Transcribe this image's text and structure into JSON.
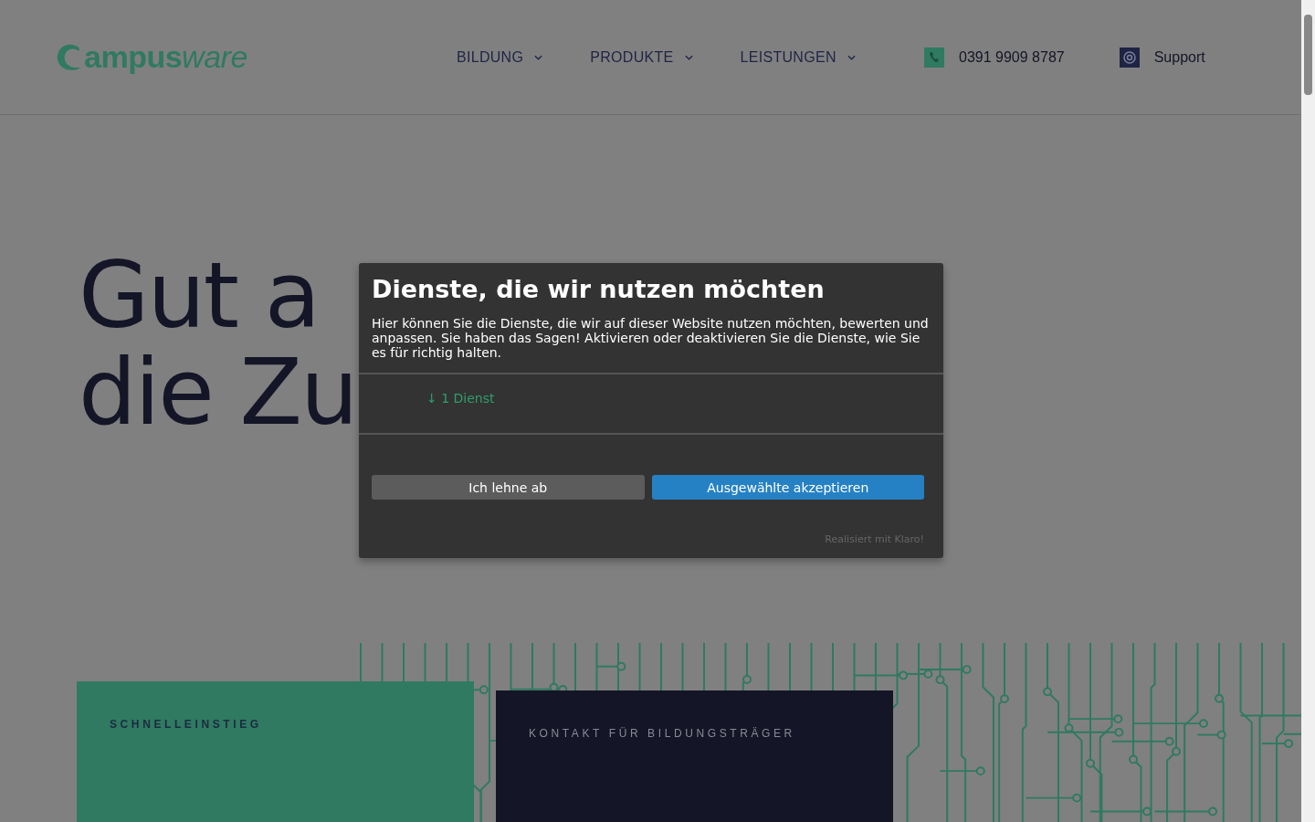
{
  "header": {
    "logo": {
      "bold": "ampus",
      "light": "ware"
    },
    "nav": [
      {
        "label": "BILDUNG",
        "has_dropdown": true
      },
      {
        "label": "PRODUKTE",
        "has_dropdown": true
      },
      {
        "label": "LEISTUNGEN",
        "has_dropdown": true
      }
    ],
    "phone": "0391 9909 8787",
    "support": "Support"
  },
  "hero": {
    "lines": [
      "Gut a",
      "die Zu"
    ]
  },
  "cards": [
    {
      "label": "SCHNELLEINSTIEG",
      "color": "#2f7a60"
    },
    {
      "label": "KONTAKT FÜR BILDUNGSTRÄGER",
      "color": "#141526"
    }
  ],
  "consent_modal": {
    "title": "Dienste, die wir nutzen möchten",
    "description": "Hier können Sie die Dienste, die wir auf dieser Website nutzen möchten, bewerten und anpassen. Sie haben das Sagen! Aktivieren oder deaktivieren Sie die Dienste, wie Sie es für richtig halten.",
    "services_toggle": "↓ 1 Dienst",
    "decline": "Ich lehne ab",
    "accept": "Ausgewählte akzeptieren",
    "powered_by": "Realisiert mit Klaro!"
  }
}
